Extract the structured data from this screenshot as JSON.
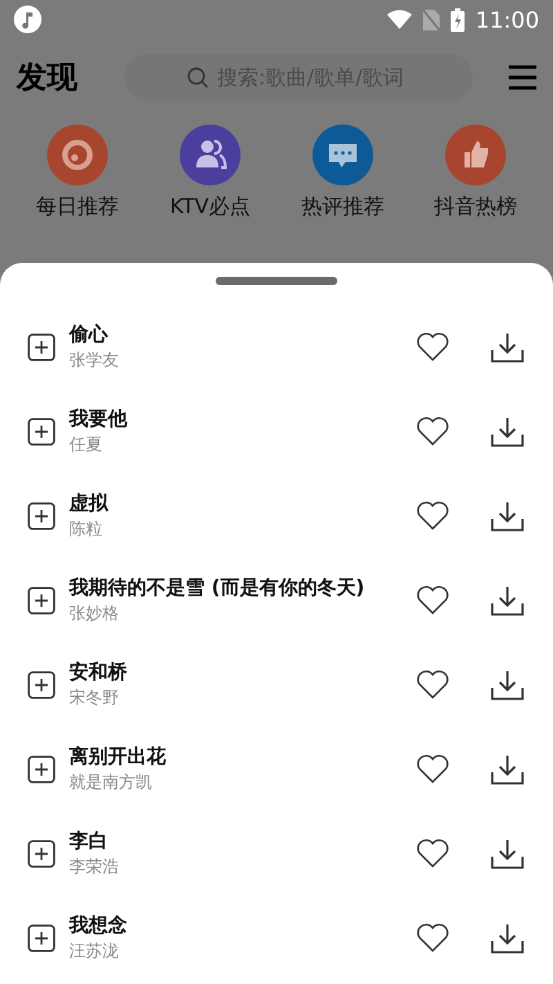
{
  "status_bar": {
    "time": "11:00"
  },
  "header": {
    "title": "发现",
    "search": {
      "placeholder": "搜索:歌曲/歌单/歌词"
    }
  },
  "categories": [
    {
      "label": "每日推荐",
      "kind": "disc",
      "color": "#a8452f"
    },
    {
      "label": "KTV必点",
      "kind": "people",
      "color": "#4a3f9c"
    },
    {
      "label": "热评推荐",
      "kind": "chat",
      "color": "#0e5a96"
    },
    {
      "label": "抖音热榜",
      "kind": "thumb",
      "color": "#a8452f"
    }
  ],
  "songs": [
    {
      "title": "偷心",
      "artist": "张学友"
    },
    {
      "title": "我要他",
      "artist": "任夏"
    },
    {
      "title": "虚拟",
      "artist": "陈粒"
    },
    {
      "title": "我期待的不是雪 (而是有你的冬天)",
      "artist": "张妙格"
    },
    {
      "title": "安和桥",
      "artist": "宋冬野"
    },
    {
      "title": "离别开出花",
      "artist": "就是南方凯"
    },
    {
      "title": "李白",
      "artist": "李荣浩"
    },
    {
      "title": "我想念",
      "artist": "汪苏泷"
    }
  ]
}
